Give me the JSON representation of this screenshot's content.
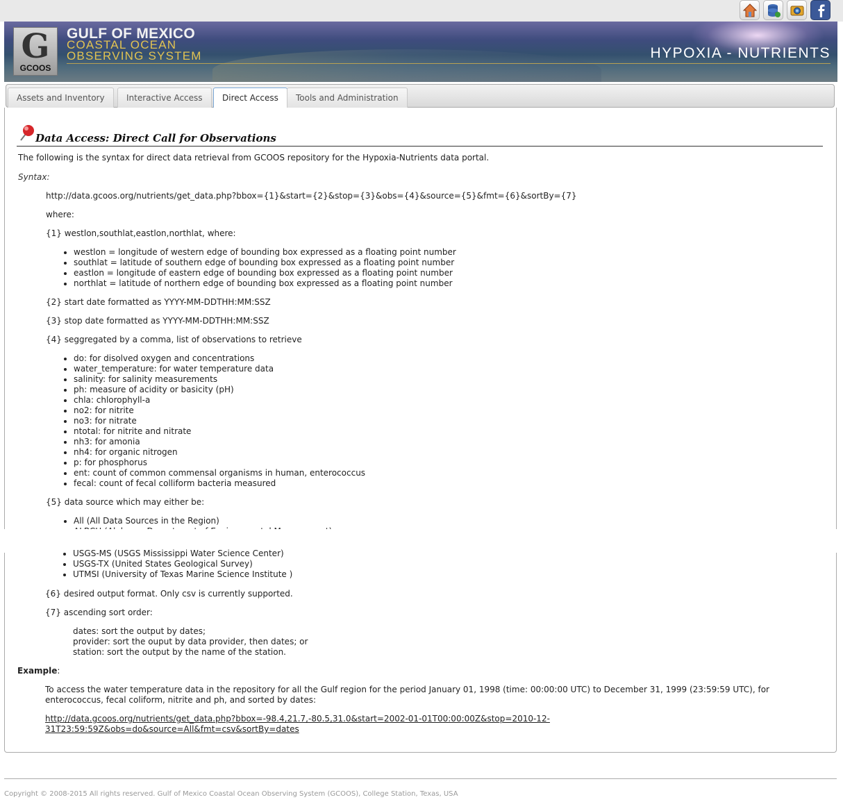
{
  "header": {
    "org_line1": "GULF OF MEXICO",
    "org_line2": "COASTAL OCEAN",
    "org_line3": "OBSERVING SYSTEM",
    "logo_text": "GCOOS",
    "portal_title": "HYPOXIA - NUTRIENTS"
  },
  "top_icons": [
    "home-icon",
    "database-icon",
    "camera-icon",
    "facebook-icon"
  ],
  "tabs": [
    {
      "label": "Assets and Inventory",
      "active": false
    },
    {
      "label": "Interactive Access",
      "active": false
    },
    {
      "label": "Direct Access",
      "active": true
    },
    {
      "label": "Tools and Administration",
      "active": false
    }
  ],
  "content": {
    "title": "Data Access: Direct Call for Observations",
    "intro": "The following is the syntax for direct data retrieval from GCOOS repository for the Hypoxia-Nutrients data portal.",
    "syntax_label": "Syntax:",
    "syntax_url": "http://data.gcoos.org/nutrients/get_data.php?bbox={1}&start={2}&stop={3}&obs={4}&source={5}&fmt={6}&sortBy={7}",
    "where": "where:",
    "p1": "{1} westlon,southlat,eastlon,northlat, where:",
    "bbox_items": [
      "westlon = longitude of western edge of bounding box expressed as a floating point number",
      "southlat = latitude of southern edge of bounding box expressed as a floating point number",
      "eastlon = longitude of eastern edge of bounding box expressed as a floating point number",
      "northlat = latitude of northern edge of bounding box expressed as a floating point number"
    ],
    "p2": "{2} start date formatted as YYYY-MM-DDTHH:MM:SSZ",
    "p3": "{3} stop date formatted as YYYY-MM-DDTHH:MM:SSZ",
    "p4": "{4} seggregated by a comma, list of observations to retrieve",
    "obs_items": [
      "do: for disolved oxygen and concentrations",
      "water_temperature: for water temperature data",
      "salinity: for salinity measurements",
      "ph: measure of acidity or basicity (pH)",
      "chla: chlorophyll-a",
      "no2: for nitrite",
      "no3: for nitrate",
      "ntotal: for nitrite and nitrate",
      "nh3: for amonia",
      "nh4: for organic nitrogen",
      "p: for phosphorus",
      "ent: count of common commensal organisms in human, enterococcus",
      "fecal: count of fecal colliform bacteria measured"
    ],
    "p5": "{5} data source which may either be:",
    "source_items_top": [
      "All (All Data Sources in the Region)",
      "ALBCH (Alabama Department of Environmental Management)"
    ],
    "source_items_bottom": [
      "USGS-MS (USGS Mississippi Water Science Center)",
      "USGS-TX (United States Geological Survey)",
      "UTMSI (University of Texas Marine Science Institute )"
    ],
    "p6": "{6} desired output format. Only csv is currently supported.",
    "p7": "{7} ascending sort order:",
    "sort_items": [
      "dates: sort the output by dates;",
      "provider: sort the ouput by data provider, then dates; or",
      "station: sort the output by the name of the station."
    ],
    "example_label": "Example",
    "example_colon": ":",
    "example_text_1": "To access the water temperature data in the repository for all the Gulf region for the period January 01, 1998 (time: 00:00:00 UTC) to December 31, 1999 (23:59:59 UTC), for",
    "example_text_2": "enterococcus, fecal coliform, nitrite and ph, and sorted by dates:",
    "example_link_1": "http://data.gcoos.org/nutrients/get_data.php?bbox=-98.4,21.7,-80.5,31.0&start=2002-01-01T00:00:00Z&stop=2010-12-",
    "example_link_2": "31T23:59:59Z&obs=do&source=All&fmt=csv&sortBy=dates"
  },
  "footer": {
    "copyright": "Copyright © 2008-2015 All rights reserved. Gulf of Mexico Coastal Ocean Observing System (GCOOS), College Station, Texas, USA"
  }
}
